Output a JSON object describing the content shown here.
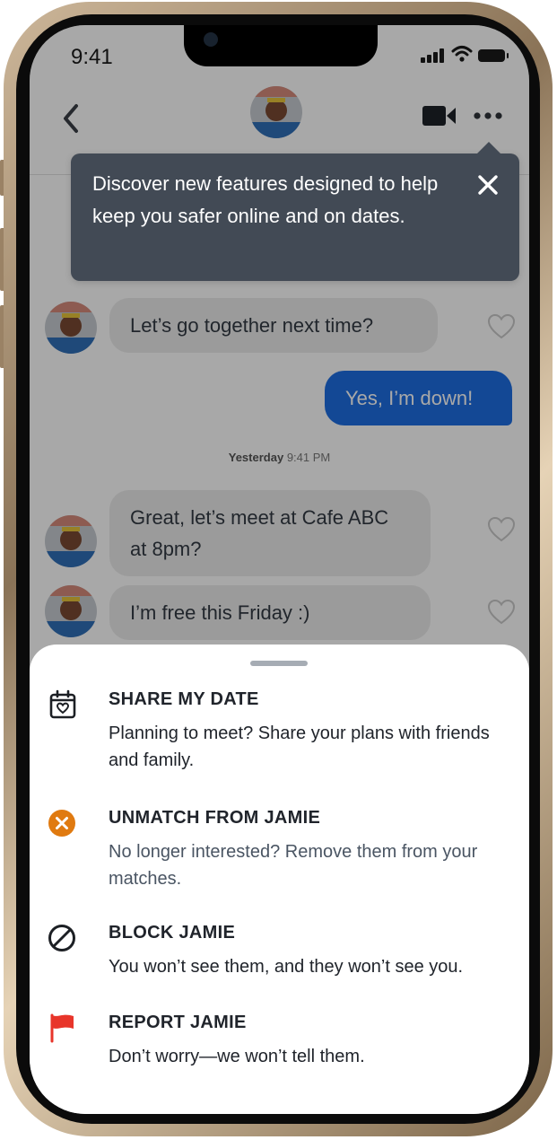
{
  "status_bar": {
    "time": "9:41"
  },
  "header": {
    "back_icon": "chevron-left-icon",
    "video_icon": "video-camera-icon",
    "more_icon": "more-horizontal-icon"
  },
  "tooltip": {
    "text": "Discover new features designed to help keep you safer online and on dates.",
    "close_icon": "close-icon"
  },
  "messages": [
    {
      "direction": "incoming",
      "text": "Let’s go together next time?"
    },
    {
      "direction": "outgoing",
      "text": "Yes, I’m down!"
    },
    {
      "direction": "incoming",
      "text": "Great, let’s meet at Cafe ABC at 8pm?"
    },
    {
      "direction": "incoming",
      "text": "I’m free this Friday :)"
    }
  ],
  "timestamp": {
    "day": "Yesterday",
    "time": "9:41 PM"
  },
  "sheet": {
    "options": [
      {
        "icon": "calendar-heart-icon",
        "title": "SHARE MY DATE",
        "description": "Planning to meet? Share your plans with friends and family."
      },
      {
        "icon": "unmatch-x-icon",
        "title": "UNMATCH FROM JAMIE",
        "description": "No longer interested? Remove them from your matches."
      },
      {
        "icon": "block-icon",
        "title": "BLOCK JAMIE",
        "description": "You won’t see them, and they won’t see you."
      },
      {
        "icon": "flag-icon",
        "title": "REPORT JAMIE",
        "description": "Don’t worry—we won’t tell them."
      }
    ]
  },
  "colors": {
    "accent_blue": "#1e6ee2",
    "tooltip_bg": "#424a55",
    "unmatch_orange": "#e07a10",
    "report_red": "#e8352a"
  }
}
